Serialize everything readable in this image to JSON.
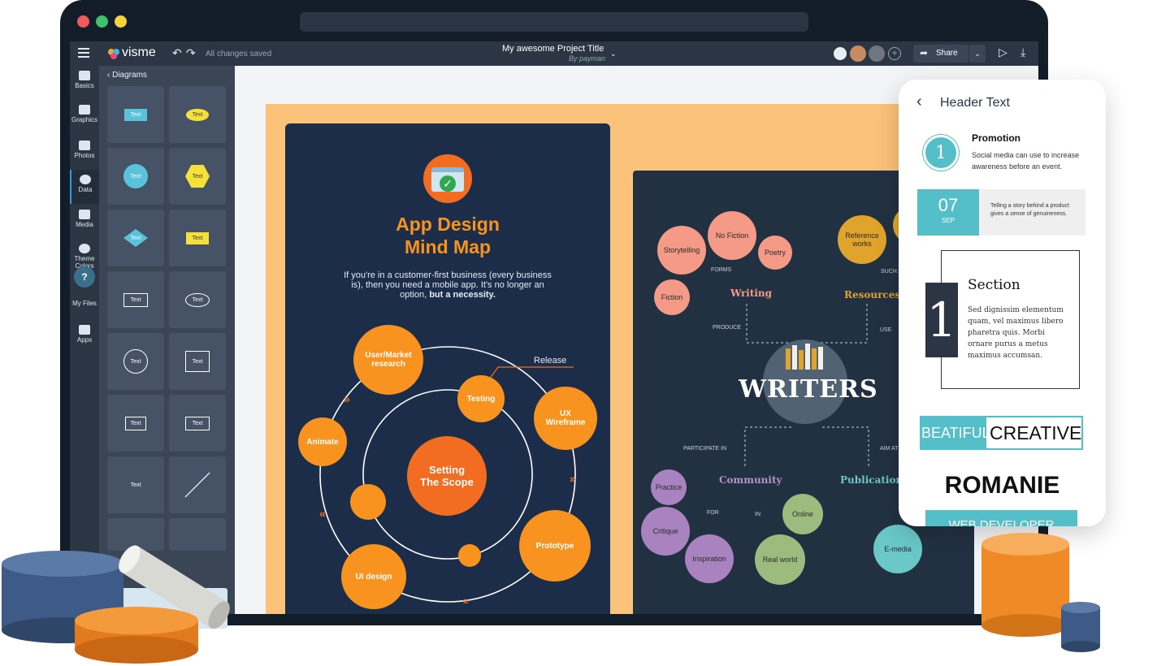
{
  "app": {
    "logo": "visme",
    "save_status": "All changes saved",
    "project_title": "My awesome Project Title",
    "project_author": "By payman",
    "share_label": "Share",
    "help_label": "?"
  },
  "rail": [
    {
      "label": "Basics",
      "icon": "basics-icon"
    },
    {
      "label": "Graphics",
      "icon": "graphics-icon"
    },
    {
      "label": "Photos",
      "icon": "photos-icon"
    },
    {
      "label": "Data",
      "icon": "data-icon"
    },
    {
      "label": "Media",
      "icon": "media-icon"
    },
    {
      "label": "Theme Colors",
      "icon": "palette-icon"
    },
    {
      "label": "My Files",
      "icon": "files-icon"
    },
    {
      "label": "Apps",
      "icon": "apps-icon"
    }
  ],
  "panel": {
    "back_label": "Diagrams",
    "tile_text": "Text"
  },
  "mindmap": {
    "title_line1": "App Design",
    "title_line2": "Mind Map",
    "desc": "If you're in a customer-first business (every business is), then you need a mobile app. It's no longer an option,",
    "desc_bold": "but a necessity.",
    "release": "Release",
    "center": "Setting The Scope",
    "nodes": {
      "research": "User/Market research",
      "testing": "Testing",
      "ux": "UX Wireframe",
      "animate": "Animate",
      "prototype": "Prototype",
      "ui": "UI design"
    }
  },
  "writers": {
    "title": "WRITERS",
    "branches": {
      "writing": "Writing",
      "resources": "Resources",
      "community": "Community",
      "publication": "Publication"
    },
    "links": {
      "forms": "FORMS",
      "produce": "PRODUCE",
      "such_as": "SUCH A",
      "use": "USE",
      "participate": "PARTICIPATE IN",
      "aim": "AIM AT",
      "for": "FOR",
      "in": "IN"
    },
    "bubbles": {
      "storytelling": "Storytelling",
      "no_fiction": "No Fiction",
      "poetry": "Poetry",
      "fiction": "Fiction",
      "reference": "Reference works",
      "practice": "Practice",
      "critique": "Critique",
      "inspiration": "Inspiration",
      "online": "Online",
      "real_world": "Real world",
      "emedia": "E-media"
    }
  },
  "phone": {
    "header": "Header Text",
    "promo_number": "1",
    "promo_title": "Promotion",
    "promo_text": "Social media can use to increase awareness before an event.",
    "date_day": "07",
    "date_month": "SEP",
    "date_text": "Telling a story behind a product gives a sense of genuineness.",
    "section_number": "1",
    "section_title": "Section",
    "section_text": "Sed dignissim elementum quam, vel maximus libero pharetra quis. Morbi ornare purus a metus maximus accumsan.",
    "beatiful": "BEATIFUL",
    "creative": "CREATIVE",
    "romanie": "ROMANIE",
    "cut_text": "WEB DEVELOPER"
  }
}
